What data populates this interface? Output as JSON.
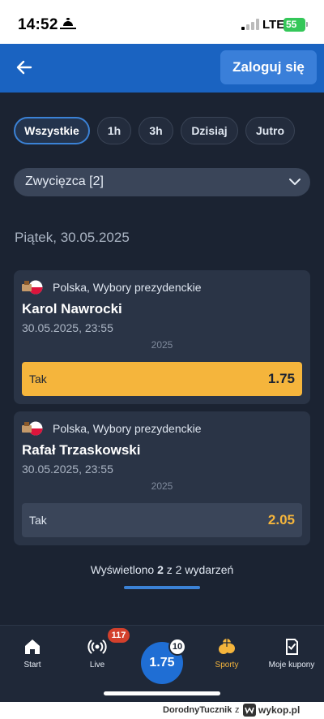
{
  "status_bar": {
    "time": "14:52",
    "network": "LTE",
    "battery": "55"
  },
  "header": {
    "login_label": "Zaloguj się"
  },
  "filters": [
    "Wszystkie",
    "1h",
    "3h",
    "Dzisiaj",
    "Jutro"
  ],
  "dropdown": {
    "label": "Zwycięzca [2]"
  },
  "date_heading": "Piątek, 30.05.2025",
  "events": [
    {
      "league": "Polska, Wybory prezydenckie",
      "name": "Karol Nawrocki",
      "datetime": "30.05.2025, 23:55",
      "year": "2025",
      "outcome": "Tak",
      "odds": "1.75",
      "selected": true
    },
    {
      "league": "Polska, Wybory prezydenckie",
      "name": "Rafał Trzaskowski",
      "datetime": "30.05.2025, 23:55",
      "year": "2025",
      "outcome": "Tak",
      "odds": "2.05",
      "selected": false
    }
  ],
  "results": {
    "prefix": "Wyświetlono",
    "shown": "2",
    "middle": "z",
    "total": "2",
    "suffix": "wydarzeń",
    "progress": 1.0
  },
  "bottom_nav": {
    "items": [
      {
        "label": "Start",
        "icon": "home-icon"
      },
      {
        "label": "Live",
        "icon": "live-icon"
      },
      {
        "label": "Sporty",
        "icon": "sports-icon"
      },
      {
        "label": "Moje kupony",
        "icon": "coupons-icon"
      }
    ],
    "live_badge": "117",
    "coupon_odds": "1.75",
    "coupon_count": "10"
  },
  "footer": {
    "user": "DorodnyTucznik",
    "z": "z",
    "brand": "wykop.pl"
  },
  "colors": {
    "accent": "#1a63c1",
    "selected_odds": "#f5b53c",
    "background": "#1b2332",
    "card": "#2a3446"
  }
}
